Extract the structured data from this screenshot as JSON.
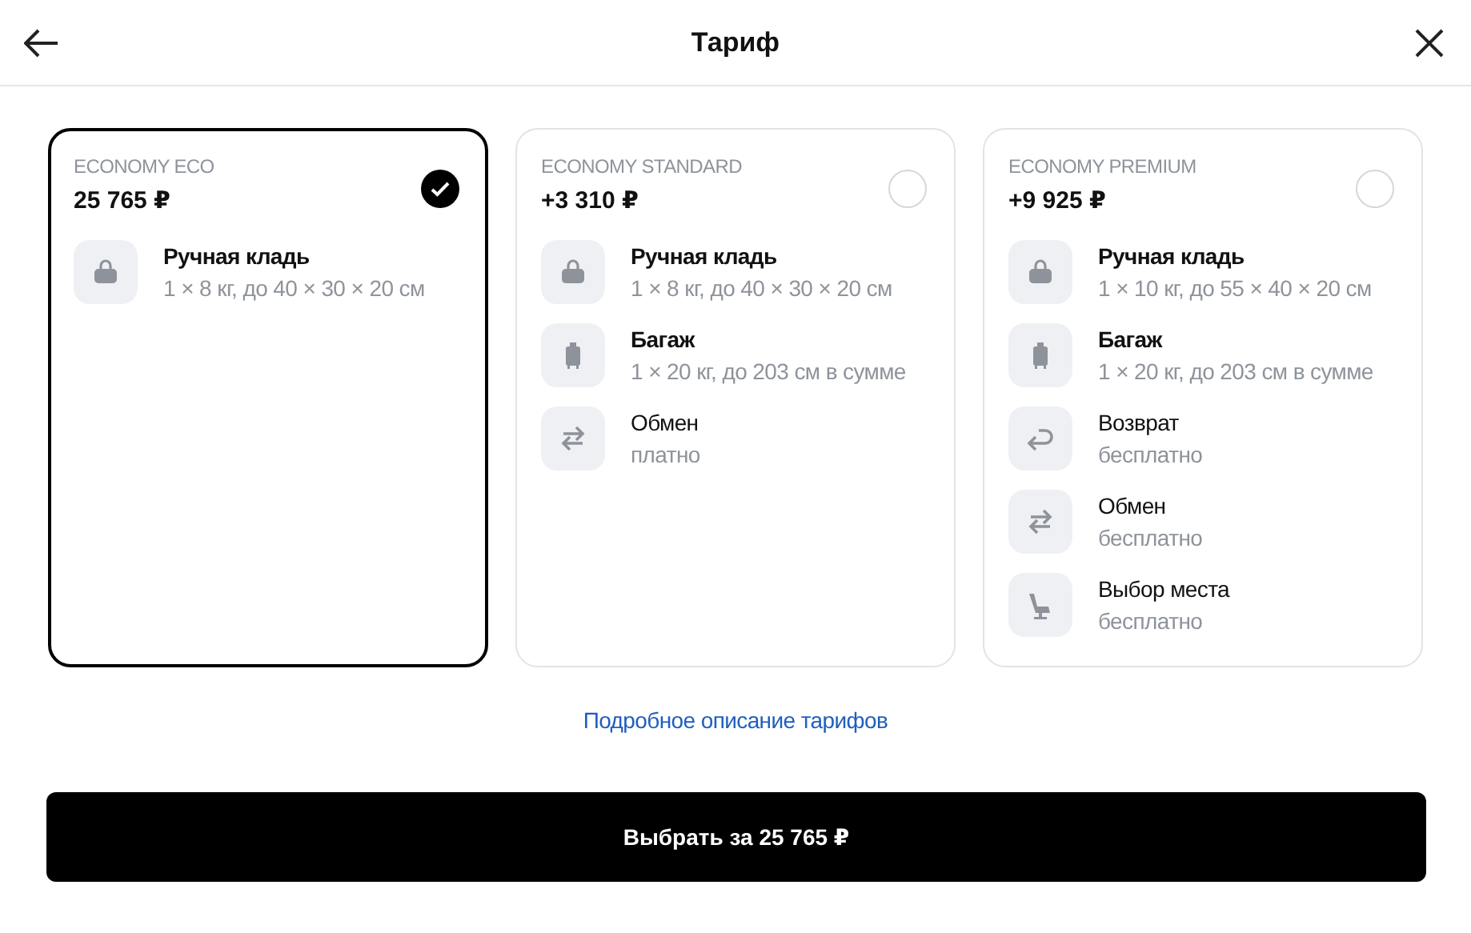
{
  "header": {
    "title": "Тариф"
  },
  "tariffs": [
    {
      "name": "ECONOMY ECO",
      "price": "25 765 ₽",
      "selected": true,
      "features": [
        {
          "kind": "bag",
          "title": "Ручная кладь",
          "detail": "1 × 8 кг, до 40 × 30 × 20 см"
        }
      ]
    },
    {
      "name": "ECONOMY STANDARD",
      "price": "+3 310 ₽",
      "selected": false,
      "features": [
        {
          "kind": "bag",
          "title": "Ручная кладь",
          "detail": "1 × 8 кг, до 40 × 30 × 20 см"
        },
        {
          "kind": "suitcase",
          "title": "Багаж",
          "detail": "1 × 20 кг, до 203 см в сумме"
        },
        {
          "kind": "exchange",
          "title": "Обмен",
          "detail": "платно"
        }
      ]
    },
    {
      "name": "ECONOMY PREMIUM",
      "price": "+9 925 ₽",
      "selected": false,
      "features": [
        {
          "kind": "bag",
          "title": "Ручная кладь",
          "detail": "1 × 10 кг, до 55 × 40 × 20 см"
        },
        {
          "kind": "suitcase",
          "title": "Багаж",
          "detail": "1 × 20 кг, до 203 см в сумме"
        },
        {
          "kind": "refund",
          "title": "Возврат",
          "detail": "бесплатно"
        },
        {
          "kind": "exchange",
          "title": "Обмен",
          "detail": "бесплатно"
        },
        {
          "kind": "seat",
          "title": "Выбор места",
          "detail": "бесплатно"
        }
      ]
    }
  ],
  "details_link": "Подробное описание тарифов",
  "submit_button": "Выбрать за 25 765 ₽"
}
